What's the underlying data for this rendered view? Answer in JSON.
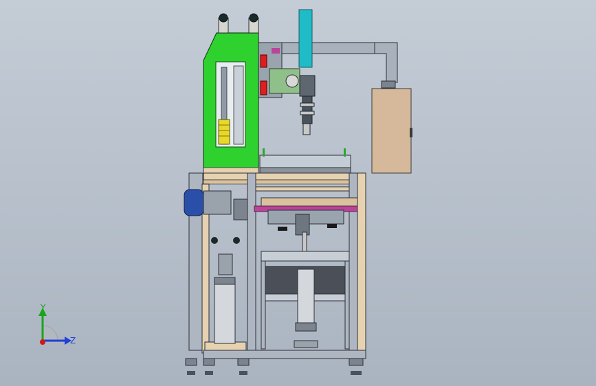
{
  "triad": {
    "y_label": "Y",
    "z_label": "Z",
    "colors": {
      "y": "#1aa51a",
      "z": "#1f3fd6",
      "x": "#d01818"
    }
  },
  "colors": {
    "background_top": "#c4ccd6",
    "background_bottom": "#aab4c0",
    "green_guard": "#2fd12f",
    "frame_wood": "#e6d2b0",
    "frame_steel": "#aeb6c2",
    "motor_blue": "#2a4fa8",
    "cyan_bar": "#1fbcc8",
    "control_box": "#d6b99a",
    "red_block": "#e01c1c",
    "magenta_part": "#b8459a",
    "yellow_part": "#e8d82a"
  }
}
